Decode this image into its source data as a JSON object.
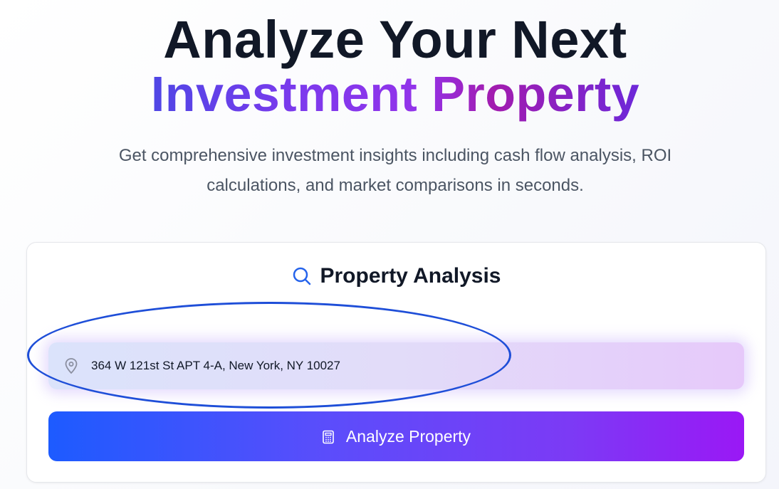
{
  "hero": {
    "line1": "Analyze Your Next",
    "line2": "Investment Property",
    "subtitle_line1": "Get comprehensive investment insights including cash flow analysis, ROI",
    "subtitle_line2": "calculations, and market comparisons in seconds."
  },
  "card": {
    "title": "Property Analysis",
    "title_icon": "search-icon",
    "address_input": {
      "value": "364 W 121st St APT 4-A, New York, NY 10027",
      "icon": "map-pin-icon"
    },
    "analyze_button": {
      "label": "Analyze Property",
      "icon": "calculator-icon"
    }
  },
  "colors": {
    "title_dark": "#111827",
    "gradient_start": "#4f46e5",
    "gradient_end": "#9333ea",
    "button_start": "#1d5bff",
    "button_end": "#9a18f5",
    "annotation": "#1e4ed8"
  }
}
